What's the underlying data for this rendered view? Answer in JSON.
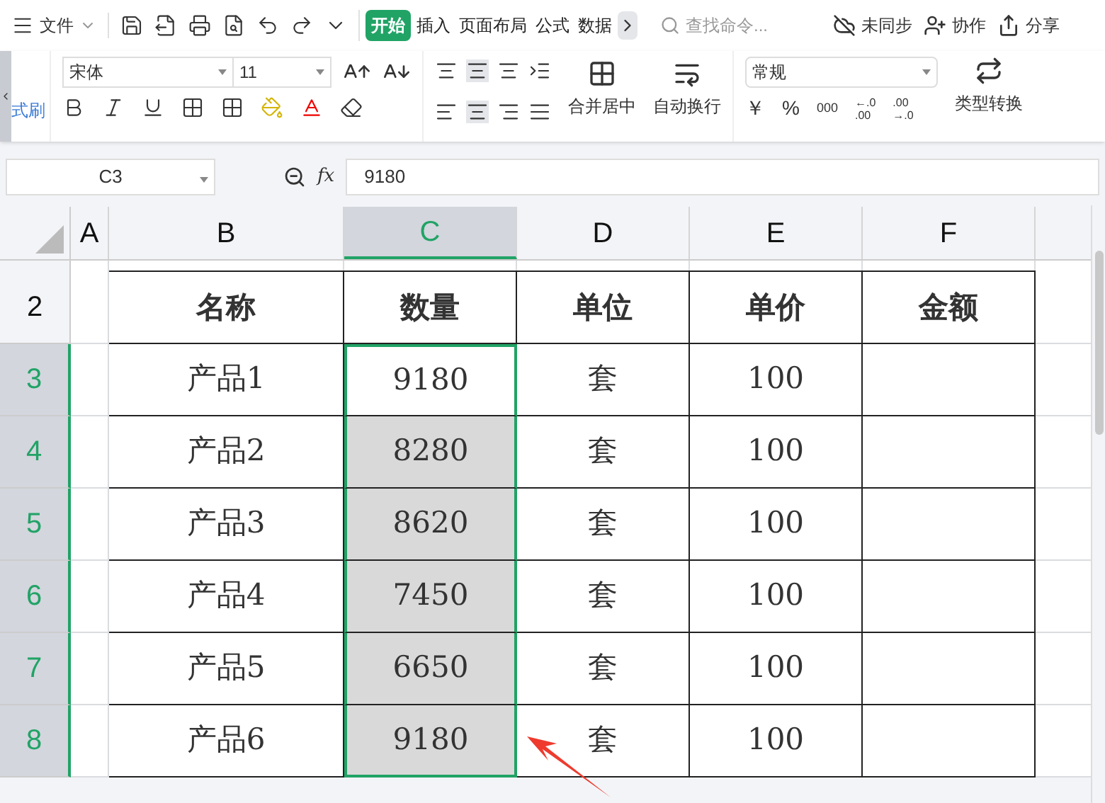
{
  "toolbar": {
    "menu": "文件",
    "tabs": [
      {
        "label": "开始",
        "selected": true
      },
      {
        "label": "插入",
        "selected": false
      },
      {
        "label": "页面布局",
        "selected": false
      },
      {
        "label": "公式",
        "selected": false
      },
      {
        "label": "数据",
        "selected": false
      }
    ],
    "search": {
      "placeholder": "查找命令..."
    },
    "actions": [
      "未同步",
      "协作",
      "分享"
    ]
  },
  "ribbon": {
    "clipboard_label": "式刷",
    "font": "宋体",
    "size": "11",
    "merge": "合并居中",
    "wrap": "自动换行",
    "number_format": "常规",
    "currency": "￥",
    "percent": "%",
    "thousands": "000",
    "increase_decimal": [
      "←.0",
      ".00"
    ],
    "decrease_decimal": [
      ".00",
      "→.0"
    ],
    "convert": "类型转换"
  },
  "formula_bar": {
    "cell": "C3",
    "function_label": "fx",
    "value": "9180"
  },
  "sheet": {
    "columns": [
      {
        "label": "A",
        "selected": false
      },
      {
        "label": "B",
        "selected": false
      },
      {
        "label": "C",
        "selected": true
      },
      {
        "label": "D",
        "selected": false
      },
      {
        "label": "E",
        "selected": false
      },
      {
        "label": "F",
        "selected": false
      }
    ],
    "header_row": {
      "number": "2",
      "cells": [
        "",
        "名称",
        "数量",
        "单位",
        "单价",
        "金额"
      ]
    },
    "rows": [
      {
        "number": "3",
        "selected": true,
        "cells": [
          "",
          "产品1",
          "9180",
          "套",
          "100",
          ""
        ]
      },
      {
        "number": "4",
        "selected": true,
        "cells": [
          "",
          "产品2",
          "8280",
          "套",
          "100",
          ""
        ]
      },
      {
        "number": "5",
        "selected": true,
        "cells": [
          "",
          "产品3",
          "8620",
          "套",
          "100",
          ""
        ]
      },
      {
        "number": "6",
        "selected": true,
        "cells": [
          "",
          "产品4",
          "7450",
          "套",
          "100",
          ""
        ]
      },
      {
        "number": "7",
        "selected": true,
        "cells": [
          "",
          "产品5",
          "6650",
          "套",
          "100",
          ""
        ]
      },
      {
        "number": "8",
        "selected": true,
        "cells": [
          "",
          "产品6",
          "9180",
          "套",
          "100",
          ""
        ]
      }
    ]
  }
}
